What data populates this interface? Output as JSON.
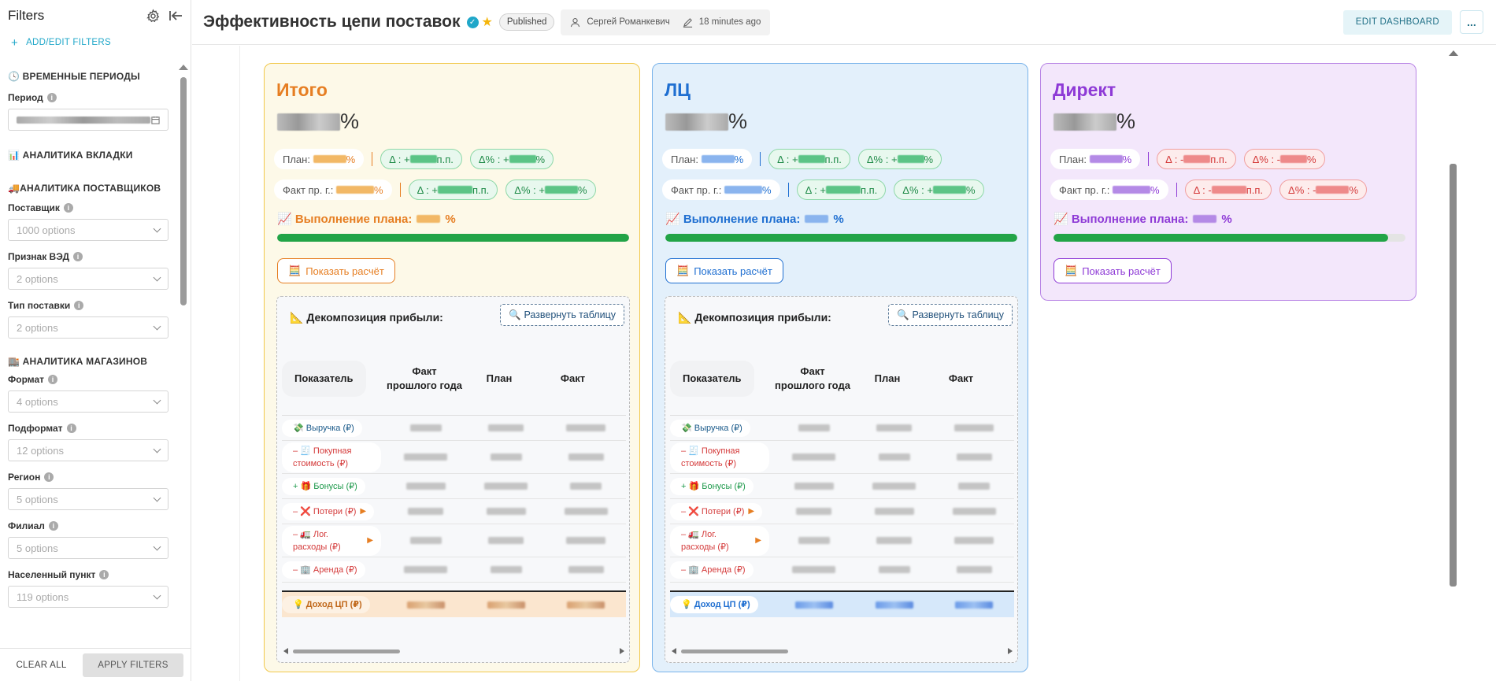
{
  "sidebar": {
    "title": "Filters",
    "add_filters": "ADD/EDIT FILTERS",
    "sections": {
      "time": "🕓 ВРЕМЕННЫЕ ПЕРИОДЫ",
      "tab": "📊 АНАЛИТИКА ВКЛАДКИ",
      "suppliers": "🚚АНАЛИТИКА ПОСТАВЩИКОВ",
      "stores": "🏬 АНАЛИТИКА МАГАЗИНОВ"
    },
    "filters": {
      "period": {
        "label": "Период"
      },
      "supplier": {
        "label": "Поставщик",
        "value": "1000 options"
      },
      "ved": {
        "label": "Признак ВЭД",
        "value": "2 options"
      },
      "delivery": {
        "label": "Тип поставки",
        "value": "2 options"
      },
      "format": {
        "label": "Формат",
        "value": "4 options"
      },
      "subformat": {
        "label": "Подформат",
        "value": "12 options"
      },
      "region": {
        "label": "Регион",
        "value": "5 options"
      },
      "branch": {
        "label": "Филиал",
        "value": "5 options"
      },
      "city": {
        "label": "Населенный пункт",
        "value": "119 options"
      }
    },
    "clear_all": "CLEAR ALL",
    "apply": "APPLY FILTERS"
  },
  "header": {
    "title": "Эффективность цепи поставок",
    "status": "Published",
    "owner": "Сергей Романкевич",
    "modified": "18 minutes ago",
    "edit": "EDIT DASHBOARD",
    "more": "..."
  },
  "cards": [
    {
      "title": "Итого",
      "percent_sign": "%",
      "plan_label": "План:",
      "fact_label": "Факт пр. г.:",
      "delta_abs_label": "Δ : +",
      "delta_abs_unit": " п.п.",
      "delta_rel_label": "Δ% : +",
      "delta_rel_unit": "%",
      "exec_label": "📈 Выполнение плана:",
      "exec_fill": 1.0,
      "show_btn": "Показать расчёт",
      "colors": {
        "accent": "#e67e22",
        "bg": "#fdf9e8",
        "border": "#f1c84b"
      }
    },
    {
      "title": "ЛЦ",
      "percent_sign": "%",
      "plan_label": "План:",
      "fact_label": "Факт пр. г.:",
      "delta_abs_label": "Δ : +",
      "delta_abs_unit": " п.п.",
      "delta_rel_label": "Δ% : +",
      "delta_rel_unit": "%",
      "exec_label": "📈 Выполнение плана:",
      "exec_fill": 1.0,
      "show_btn": "Показать расчёт",
      "colors": {
        "accent": "#1f6fd1",
        "bg": "#e3f0fb",
        "border": "#79b3ea"
      }
    },
    {
      "title": "Директ",
      "percent_sign": "%",
      "plan_label": "План:",
      "fact_label": "Факт пр. г.:",
      "delta_abs_label": "Δ : -",
      "delta_abs_unit": " п.п.",
      "delta_rel_label": "Δ% : -",
      "delta_rel_unit": "%",
      "exec_label": "📈 Выполнение плана:",
      "exec_fill": 0.95,
      "show_btn": "Показать расчёт",
      "colors": {
        "accent": "#8e3ad6",
        "bg": "#f3e7fb",
        "border": "#b885e5"
      }
    }
  ],
  "decomposition": {
    "title": "📐 Декомпозиция прибыли:",
    "expand": "🔍 Развернуть таблицу",
    "columns": [
      "Показатель",
      "Факт прошлого года",
      "План",
      "Факт"
    ],
    "rows": [
      {
        "label": "💸 Выручка (₽)",
        "color": "#1a5a8a",
        "arrow": false
      },
      {
        "label": "– 🧾 Покупная стоимость (₽)",
        "color": "#d43a3a",
        "arrow": false
      },
      {
        "label": "+ 🎁 Бонусы (₽)",
        "color": "#1f9a4c",
        "arrow": false
      },
      {
        "label": "– ❌ Потери (₽)",
        "color": "#d43a3a",
        "arrow": true
      },
      {
        "label": "– 🚛 Лог. расходы (₽)",
        "color": "#d43a3a",
        "arrow": true
      },
      {
        "label": "– 🏢 Аренда (₽)",
        "color": "#d43a3a",
        "arrow": false
      }
    ],
    "total_label": "💡 Доход ЦП (₽)"
  }
}
